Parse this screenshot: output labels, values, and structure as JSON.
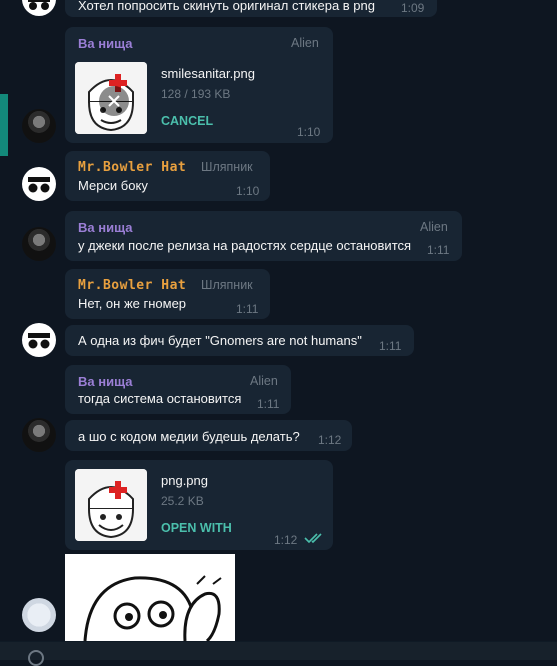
{
  "messages": {
    "m0": {
      "text": "Хотел попросить скинуть оригинал стикера в png",
      "time": "1:09"
    },
    "m1": {
      "sender": "Ва нища",
      "tag": "Alien",
      "file_name": "smilesanitar.png",
      "file_size": "128 / 193 KB",
      "action": "CANCEL",
      "time": "1:10"
    },
    "m2": {
      "sender": "Mr.Bowler Hat",
      "tag": "Шляпник",
      "text": "Мерси боку",
      "time": "1:10"
    },
    "m3": {
      "sender": "Ва нища",
      "tag": "Alien",
      "text": "у джеки после релиза на радостях сердце остановится",
      "time": "1:11"
    },
    "m4": {
      "sender": "Mr.Bowler Hat",
      "tag": "Шляпник",
      "text": "Нет, он же гномер",
      "time": "1:11"
    },
    "m5": {
      "text": "А одна из фич будет \"Gnomers are not humans\"",
      "time": "1:11"
    },
    "m6": {
      "sender": "Ва нища",
      "tag": "Alien",
      "text": "тогда система остановится",
      "time": "1:11"
    },
    "m7": {
      "text": "а шо с кодом медии будешь делать?",
      "time": "1:12"
    },
    "m8": {
      "file_name": "png.png",
      "file_size": "25.2 KB",
      "action": "OPEN WITH",
      "time": "1:12",
      "status": "read",
      "status_icon": "double-check-icon"
    }
  },
  "colors": {
    "background": "#0e1621",
    "bubble": "#182533",
    "sender_alien": "#9b7fd6",
    "sender_hat": "#e8a03f",
    "accent": "#4bbfac",
    "meta": "#6d7883"
  }
}
